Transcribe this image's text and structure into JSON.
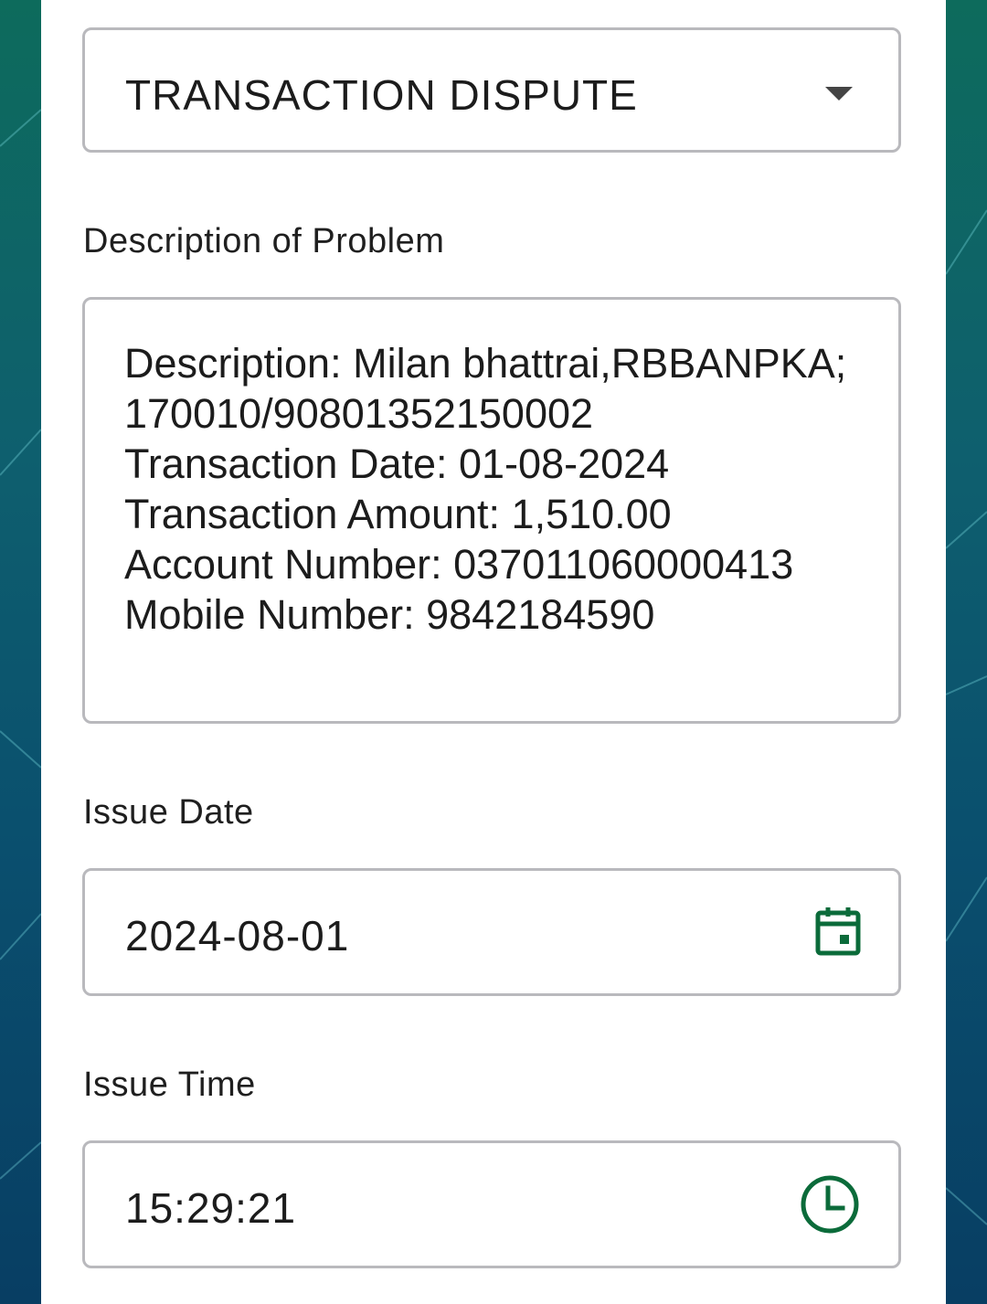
{
  "form": {
    "category": {
      "value": "TRANSACTION DISPUTE"
    },
    "description": {
      "label": "Description of Problem",
      "value": "Description: Milan bhattrai,RBBANPKA;170010/90801352150002\nTransaction Date: 01-08-2024\nTransaction Amount: 1,510.00\nAccount Number: 037011060000413\nMobile Number: 9842184590"
    },
    "issue_date": {
      "label": "Issue Date",
      "value": "2024-08-01",
      "icon": "calendar-icon"
    },
    "issue_time": {
      "label": "Issue Time",
      "value": "15:29:21",
      "icon": "clock-icon"
    }
  },
  "colors": {
    "icon_accent": "#0b6b3a",
    "field_border": "#b9b9bd",
    "background_teal": "#0d6b5c"
  }
}
